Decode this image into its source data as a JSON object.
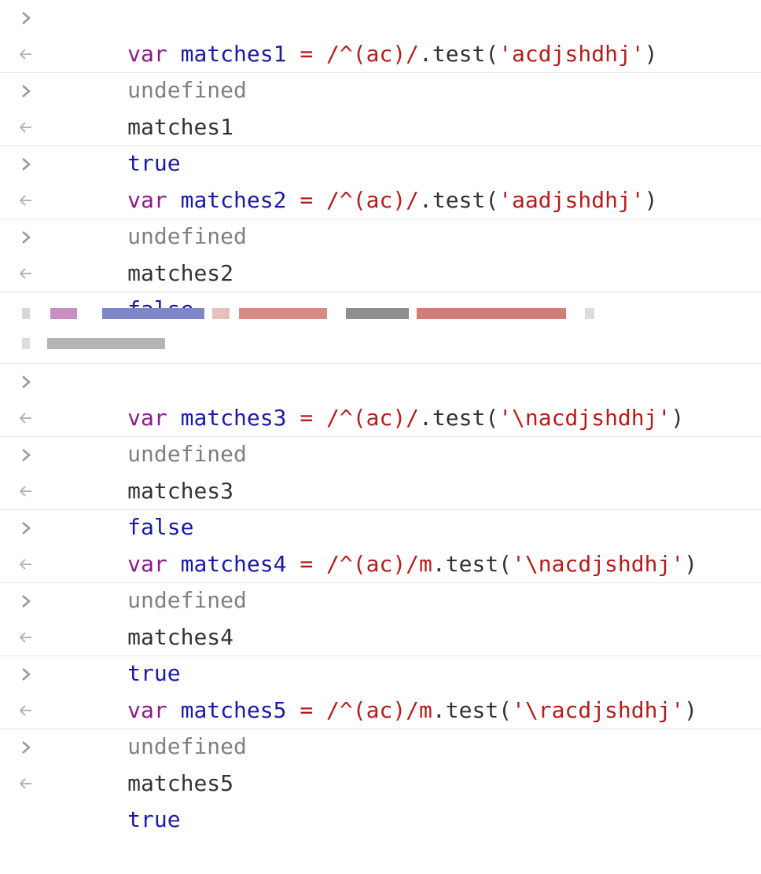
{
  "console": {
    "entries": [
      {
        "input": {
          "kw": "var",
          "id": "matches1",
          "op": "=",
          "re": "/^(ac)/",
          "method": ".test(",
          "str": "'acdjshdhj'",
          "close": ")"
        },
        "output": "undefined",
        "output_type": "undefined"
      },
      {
        "input_plain": "matches1",
        "output": "true",
        "output_type": "boolean"
      },
      {
        "input": {
          "kw": "var",
          "id": "matches2",
          "op": "=",
          "re": "/^(ac)/",
          "method": ".test(",
          "str": "'aadjshdhj'",
          "close": ")"
        },
        "output": "undefined",
        "output_type": "undefined"
      },
      {
        "input_plain": "matches2",
        "output": "false",
        "output_type": "boolean"
      },
      {
        "redacted": true
      },
      {
        "input": {
          "kw": "var",
          "id": "matches3",
          "op": "=",
          "re": "/^(ac)/",
          "method": ".test(",
          "str": "'\\nacdjshdhj'",
          "close": ")"
        },
        "output": "undefined",
        "output_type": "undefined"
      },
      {
        "input_plain": "matches3",
        "output": "false",
        "output_type": "boolean"
      },
      {
        "input": {
          "kw": "var",
          "id": "matches4",
          "op": "=",
          "re": "/^(ac)/m",
          "method": ".test(",
          "str": "'\\nacdjshdhj'",
          "close": ")"
        },
        "output": "undefined",
        "output_type": "undefined"
      },
      {
        "input_plain": "matches4",
        "output": "true",
        "output_type": "boolean"
      },
      {
        "input": {
          "kw": "var",
          "id": "matches5",
          "op": "=",
          "re": "/^(ac)/m",
          "method": ".test(",
          "str": "'\\racdjshdhj'",
          "close": ")"
        },
        "output": "undefined",
        "output_type": "undefined"
      },
      {
        "input_plain": "matches5",
        "output": "true",
        "output_type": "boolean"
      }
    ],
    "icons": {
      "input_prompt": "chevron-right-icon",
      "output_result": "return-arrow-icon"
    },
    "colors": {
      "keyword": "#8b1b8a",
      "identifier": "#1a1aa6",
      "string": "#b71c1c",
      "undefined": "#808080",
      "boolean": "#1a1aa6",
      "separator": "#e6e6e6"
    }
  }
}
